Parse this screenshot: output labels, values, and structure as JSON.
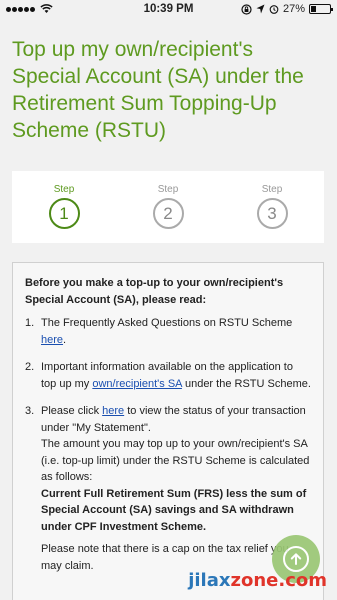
{
  "status_bar": {
    "time": "10:39 PM",
    "battery_percent": "27%",
    "battery_level": 0.27,
    "icons": [
      "signal-dots-icon",
      "wifi-icon",
      "lock-rotation-icon",
      "location-icon",
      "alarm-icon",
      "battery-icon"
    ]
  },
  "page": {
    "title": "Top up my own/recipient's Special Account (SA) under the Retirement Sum Topping-Up Scheme (RSTU)"
  },
  "stepper": {
    "current_step": 1,
    "steps": [
      {
        "label": "Step",
        "number": "1"
      },
      {
        "label": "Step",
        "number": "2"
      },
      {
        "label": "Step",
        "number": "3"
      }
    ]
  },
  "notice": {
    "intro": "Before you make a top-up to your own/recipient's Special Account (SA), please read:",
    "items": [
      {
        "num": "1.",
        "text_before": "The Frequently Asked Questions on RSTU Scheme ",
        "link": "here",
        "text_after": "."
      },
      {
        "num": "2.",
        "text_before": "Important information available on the application to top up my ",
        "link": "own/recipient's SA",
        "text_after": " under the RSTU Scheme."
      },
      {
        "num": "3.",
        "text_before": "Please click ",
        "link": "here",
        "text_after": " to view the status of your transaction under \"My Statement\".",
        "para2": "The amount you may top up to your own/recipient's SA (i.e. top-up limit) under the RSTU Scheme is calculated as follows:",
        "bold": "Current Full Retirement Sum (FRS) less the sum of Special Account (SA) savings and SA withdrawn under CPF Investment Scheme.",
        "para3": "Please note that there is a cap on the tax relief you may claim."
      }
    ]
  },
  "fab": {
    "icon": "arrow-up-icon"
  },
  "watermark": {
    "text": "jilaxzone.com",
    "colors": [
      "#2b77b8",
      "#e0342a"
    ]
  },
  "colors": {
    "accent_green": "#5e9a20",
    "link_blue": "#1a4fb0"
  }
}
